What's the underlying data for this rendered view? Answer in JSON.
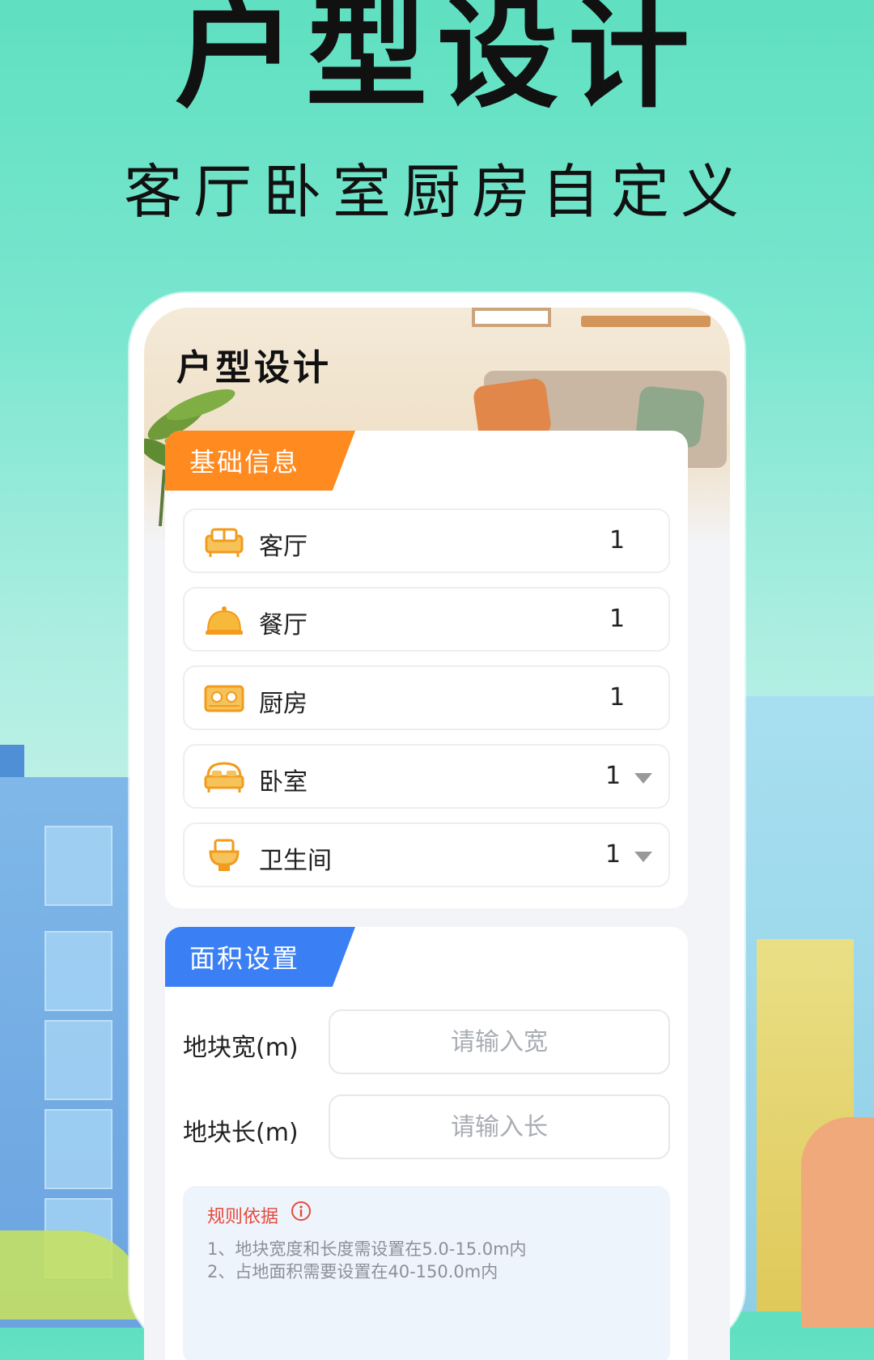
{
  "hero": {
    "title": "户型设计",
    "subtitle": "客厅卧室厨房自定义"
  },
  "screen": {
    "title": "户型设计"
  },
  "basic_info": {
    "tab_label": "基础信息",
    "rooms": [
      {
        "label": "客厅",
        "count": "1",
        "icon": "sofa-icon",
        "has_dropdown": false
      },
      {
        "label": "餐厅",
        "count": "1",
        "icon": "dining-bell-icon",
        "has_dropdown": false
      },
      {
        "label": "厨房",
        "count": "1",
        "icon": "stove-icon",
        "has_dropdown": false
      },
      {
        "label": "卧室",
        "count": "1",
        "icon": "bed-icon",
        "has_dropdown": true
      },
      {
        "label": "卫生间",
        "count": "1",
        "icon": "toilet-icon",
        "has_dropdown": true
      }
    ]
  },
  "area_settings": {
    "tab_label": "面积设置",
    "width_label": "地块宽(m)",
    "width_placeholder": "请输入宽",
    "length_label": "地块长(m)",
    "length_placeholder": "请输入长"
  },
  "rules": {
    "title": "规则依据",
    "line1": "1、地块宽度和长度需设置在5.0-15.0m内",
    "line2": "2、占地面积需要设置在40-150.0m内"
  },
  "colors": {
    "accent_orange": "#ff8a1f",
    "accent_blue": "#3b7ff5",
    "icon_orange": "#f6a623",
    "rule_red": "#e64a3b"
  }
}
